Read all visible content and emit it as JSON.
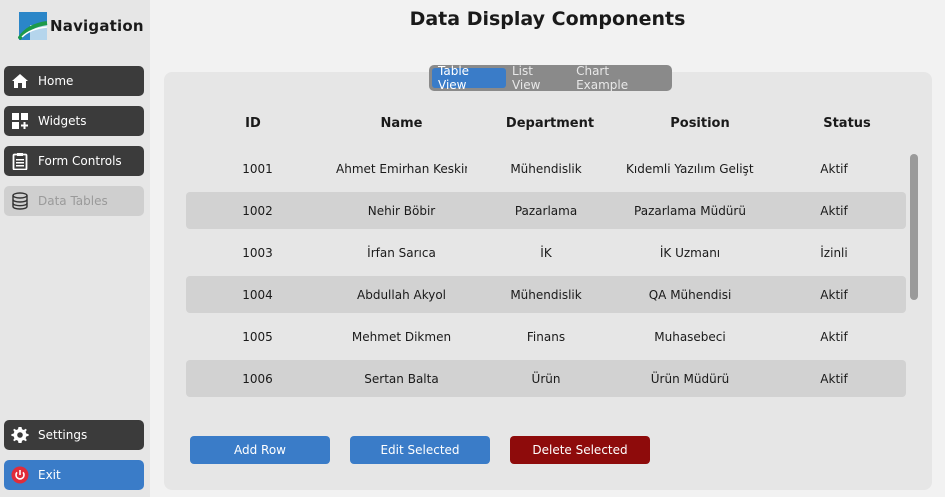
{
  "app": {
    "logo_text": "Navigation",
    "page_title": "Data Display Components"
  },
  "sidebar": {
    "items": [
      {
        "label": "Home",
        "icon": "home-icon"
      },
      {
        "label": "Widgets",
        "icon": "widgets-icon"
      },
      {
        "label": "Form Controls",
        "icon": "clipboard-icon"
      },
      {
        "label": "Data Tables",
        "icon": "database-icon",
        "state": "disabled"
      }
    ],
    "bottom": [
      {
        "label": "Settings",
        "icon": "gear-icon"
      },
      {
        "label": "Exit",
        "icon": "power-icon"
      }
    ]
  },
  "tabs": [
    {
      "label": "Table View",
      "active": true
    },
    {
      "label": "List View",
      "active": false
    },
    {
      "label": "Chart Example",
      "active": false
    }
  ],
  "table": {
    "columns": [
      "ID",
      "Name",
      "Department",
      "Position",
      "Status"
    ],
    "rows": [
      [
        "1001",
        "Ahmet Emirhan Keskin",
        "Mühendislik",
        "Kıdemli Yazılım Geliştiri",
        "Aktif"
      ],
      [
        "1002",
        "Nehir Böbir",
        "Pazarlama",
        "Pazarlama Müdürü",
        "Aktif"
      ],
      [
        "1003",
        "İrfan Sarıca",
        "İK",
        "İK Uzmanı",
        "İzinli"
      ],
      [
        "1004",
        "Abdullah Akyol",
        "Mühendislik",
        "QA Mühendisi",
        "Aktif"
      ],
      [
        "1005",
        "Mehmet Dikmen",
        "Finans",
        "Muhasebeci",
        "Aktif"
      ],
      [
        "1006",
        "Sertan Balta",
        "Ürün",
        "Ürün Müdürü",
        "Aktif"
      ]
    ]
  },
  "actions": {
    "add": "Add Row",
    "edit": "Edit Selected",
    "delete": "Delete Selected"
  },
  "colors": {
    "accent": "#3a7cc8",
    "danger": "#8e0b0b",
    "nav_dark": "#3b3b3b",
    "sidebar_bg": "#e6e6e6"
  }
}
